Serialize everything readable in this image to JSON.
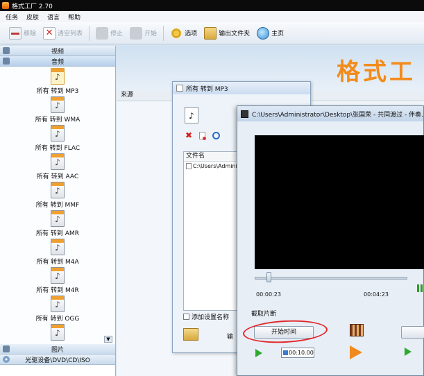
{
  "window": {
    "title": "格式工厂 2.70"
  },
  "menu": [
    "任务",
    "皮肤",
    "语言",
    "帮助"
  ],
  "toolbar": {
    "remove": "移除",
    "clear_list": "清空列表",
    "stop": "停止",
    "start": "开始",
    "options": "选项",
    "output_folder": "输出文件夹",
    "home": "主页"
  },
  "sidebar": {
    "categories": {
      "video": "视频",
      "audio": "音频",
      "image": "图片",
      "cd": "光驱设备\\DVD\\CD\\ISO"
    },
    "formats": [
      "所有 转到 MP3",
      "所有 转到 WMA",
      "所有 转到 FLAC",
      "所有 转到 AAC",
      "所有 转到 MMF",
      "所有 转到 AMR",
      "所有 转到 M4A",
      "所有 转到 M4R",
      "所有 转到 OGG"
    ]
  },
  "main": {
    "brand": "格式工",
    "source_header": "来源"
  },
  "convert_dialog": {
    "title": "所有 转到 MP3",
    "column_filename": "文件名",
    "file_row": "C:\\Users\\Admini",
    "add_setting_label": "添加设置名称",
    "bottom_label": "输"
  },
  "clip_dialog": {
    "title": "C:\\Users\\Administrator\\Desktop\\张国荣 - 共同渡过 - 伴奏.m",
    "current_time": "00:00:23",
    "end_time": "00:04:23",
    "clip_section": "截取片断",
    "start_time_button": "开始时间",
    "start_time_value": "00:10.00",
    "progress_fraction": 0.07
  },
  "colors": {
    "brand_orange": "#f38b1a",
    "highlight_red": "#e3262a",
    "play_green": "#2eaa2e"
  }
}
